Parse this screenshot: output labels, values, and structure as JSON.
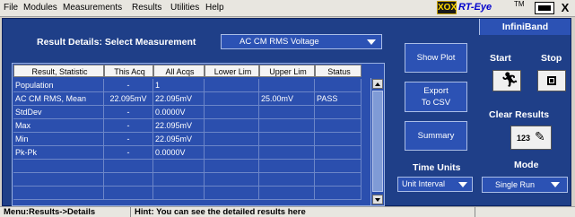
{
  "menu": [
    "File",
    "Modules",
    "Measurements",
    "Results",
    "Utilities",
    "Help"
  ],
  "logo": {
    "badge": "XOX",
    "name": "RT-Eye",
    "tm": "TM"
  },
  "close_label": "X",
  "result_details": {
    "title": "Result Details: Select Measurement",
    "measurement_selected": "AC CM RMS Voltage"
  },
  "table": {
    "columns": [
      "Result, Statistic",
      "This Acq",
      "All Acqs",
      "Lower Lim",
      "Upper Lim",
      "Status"
    ],
    "rows": [
      [
        "Population",
        "-",
        "1",
        "",
        "",
        ""
      ],
      [
        "AC CM RMS, Mean",
        "22.095mV",
        "22.095mV",
        "",
        "25.00mV",
        "PASS"
      ],
      [
        "StdDev",
        "-",
        "0.0000V",
        "",
        "",
        ""
      ],
      [
        "Max",
        "-",
        "22.095mV",
        "",
        "",
        ""
      ],
      [
        "Min",
        "-",
        "22.095mV",
        "",
        "",
        ""
      ],
      [
        "Pk-Pk",
        "-",
        "0.0000V",
        "",
        "",
        ""
      ],
      [
        "",
        "",
        "",
        "",
        "",
        ""
      ],
      [
        "",
        "",
        "",
        "",
        "",
        ""
      ],
      [
        "",
        "",
        "",
        "",
        "",
        ""
      ]
    ]
  },
  "buttons": {
    "show_plot": "Show Plot",
    "export_line1": "Export",
    "export_line2": "To CSV",
    "summary": "Summary"
  },
  "time_units": {
    "title": "Time Units",
    "value": "Unit Interval"
  },
  "panel": {
    "header": "InfiniBand",
    "start": "Start",
    "stop": "Stop",
    "clear_results": "Clear Results",
    "eraser_number": "123",
    "mode_title": "Mode",
    "mode_value": "Single Run"
  },
  "status": {
    "menu_path": "Menu:Results->Details",
    "hint": "Hint: You can see the detailed results here"
  }
}
